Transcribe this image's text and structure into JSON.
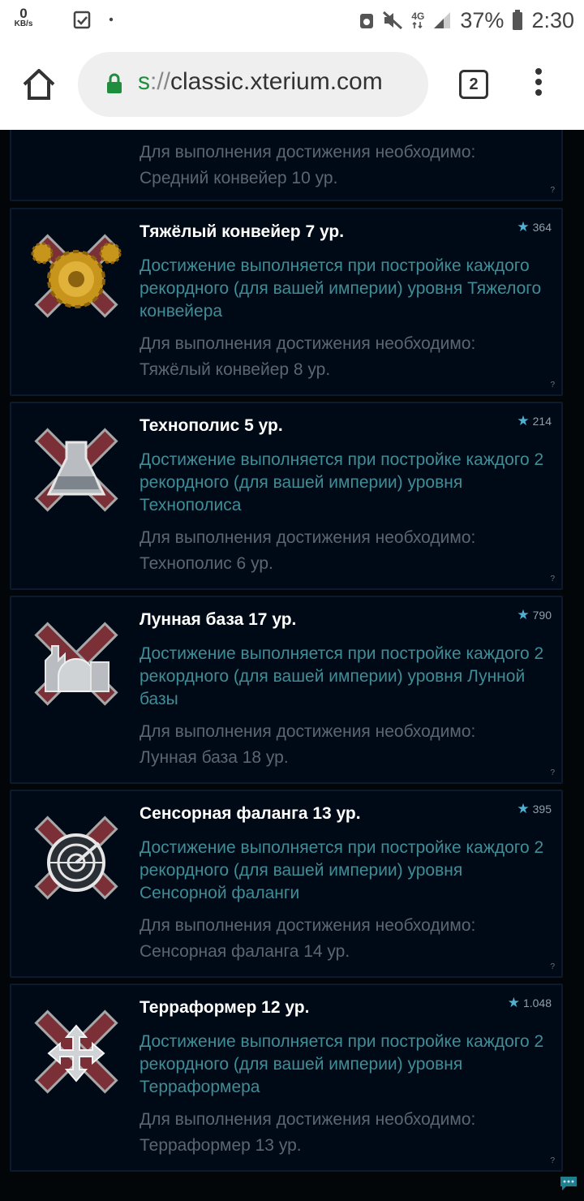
{
  "status_bar": {
    "speed_value": "0",
    "speed_unit": "KB/s",
    "network": "4G",
    "battery": "37%",
    "time": "2:30"
  },
  "browser": {
    "url_scheme": "s",
    "url_sep": "://",
    "url_host": "classic.xterium.com",
    "tab_count": "2"
  },
  "achievements": [
    {
      "title": "",
      "description": "",
      "requirement_label": "Для выполнения достижения необходимо:",
      "requirement_value": "Средний конвейер 10 ур.",
      "points": "",
      "help": "?"
    },
    {
      "title": "Тяжёлый конвейер 7 ур.",
      "description": "Достижение выполняется при постройке каждого рекордного (для вашей империи) уровня Тяжелого конвейера",
      "requirement_label": "Для выполнения достижения необходимо:",
      "requirement_value": "Тяжёлый конвейер 8 ур.",
      "points": "364",
      "help": "?",
      "icon": "gear-emblem-icon"
    },
    {
      "title": "Технополис 5 ур.",
      "description": "Достижение выполняется при постройке каждого 2 рекордного (для вашей империи) уровня Технополиса",
      "requirement_label": "Для выполнения достижения необходимо:",
      "requirement_value": "Технополис 6 ур.",
      "points": "214",
      "help": "?",
      "icon": "flask-emblem-icon"
    },
    {
      "title": "Лунная база 17 ур.",
      "description": "Достижение выполняется при постройке каждого 2 рекордного (для вашей империи) уровня Лунной базы",
      "requirement_label": "Для выполнения достижения необходимо:",
      "requirement_value": "Лунная база 18 ур.",
      "points": "790",
      "help": "?",
      "icon": "moonbase-emblem-icon"
    },
    {
      "title": "Сенсорная фаланга 13 ур.",
      "description": "Достижение выполняется при постройке каждого 2 рекордного (для вашей империи) уровня Сенсорной фаланги",
      "requirement_label": "Для выполнения достижения необходимо:",
      "requirement_value": "Сенсорная фаланга 14 ур.",
      "points": "395",
      "help": "?",
      "icon": "radar-emblem-icon"
    },
    {
      "title": "Терраформер 12 ур.",
      "description": "Достижение выполняется при постройке каждого 2 рекордного (для вашей империи) уровня Терраформера",
      "requirement_label": "Для выполнения достижения необходимо:",
      "requirement_value": "Терраформер 13 ур.",
      "points": "1.048",
      "help": "?",
      "icon": "terraformer-emblem-icon"
    }
  ]
}
